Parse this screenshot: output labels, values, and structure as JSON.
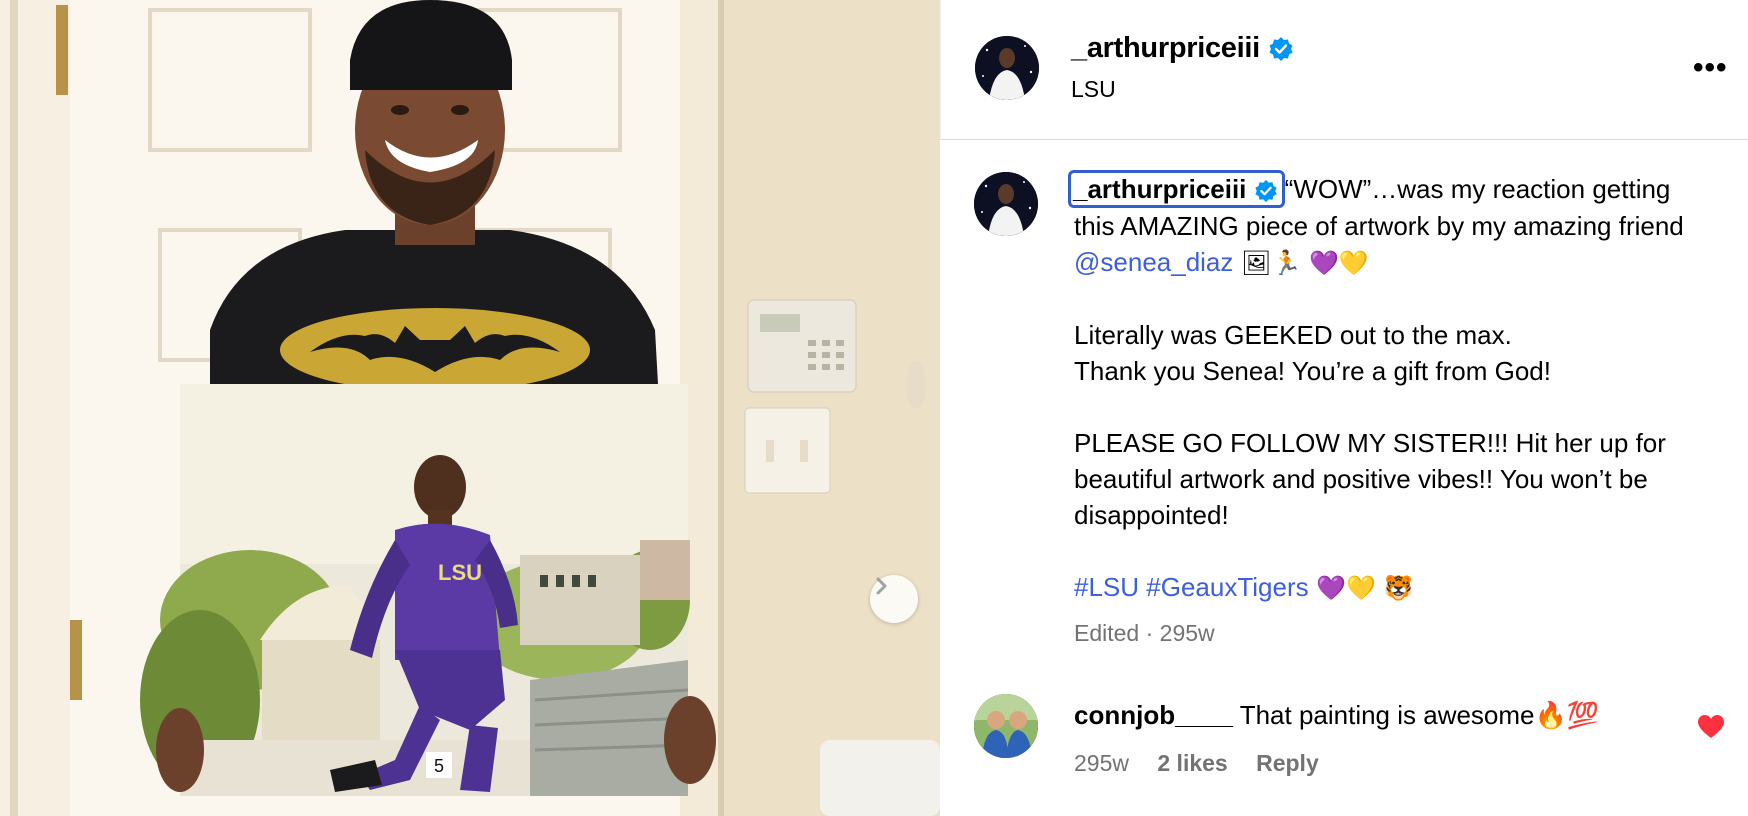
{
  "post": {
    "username": "_arthurpriceiii",
    "location": "LSU",
    "more_label": "•••"
  },
  "caption": {
    "username": "_arthurpriceiii",
    "line1": "“WOW”…was my reaction getting this AMAZING piece of artwork by my amazing friend ",
    "mention": "@senea_diaz",
    "line1_emojis": " 🖼🏃 💜💛",
    "para2a": "Literally was GEEKED out to the max.",
    "para2b": "Thank you Senea! You’re a gift from God!",
    "para3": "PLEASE GO FOLLOW MY SISTER!!! Hit her up for beautiful artwork and positive vibes!! You won’t be disappointed!",
    "hashtag1": "#LSU",
    "hashtag2": "#GeauxTigers",
    "hashtag_emojis": " 💜💛 🐯",
    "meta": "Edited · 295w"
  },
  "comment": {
    "username": "connjob____",
    "text": " That painting is awesome🔥💯",
    "age": "295w",
    "likes": "2 likes",
    "reply": "Reply"
  },
  "media": {
    "painting_shirt_text": "LSU",
    "bib_number": "5",
    "next_icon": "chevron-right-icon"
  },
  "colors": {
    "link": "#3d5fd9",
    "verified": "#0095f6",
    "heart": "#ff3040",
    "muted": "#737373",
    "lsu_purple": "#5b3aa6"
  }
}
